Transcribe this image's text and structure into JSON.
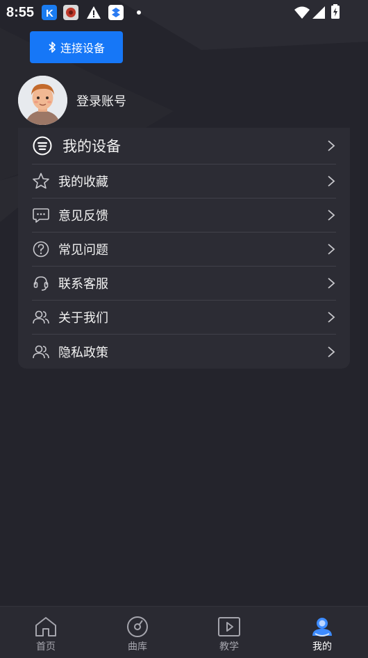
{
  "status_bar": {
    "time": "8:55",
    "icons": [
      "k-app-icon",
      "red-app-icon",
      "warning-icon",
      "layers-app-icon",
      "dot-icon",
      "wifi-icon",
      "signal-icon",
      "battery-charging-icon"
    ]
  },
  "header": {
    "connect_label": "连接设备",
    "connect_icon": "bluetooth-icon"
  },
  "profile": {
    "login_text": "登录账号",
    "avatar_icon": "user-avatar"
  },
  "menu": {
    "items": [
      {
        "label": "我的设备",
        "icon": "device-list-icon"
      },
      {
        "label": "我的收藏",
        "icon": "star-icon"
      },
      {
        "label": "意见反馈",
        "icon": "chat-bubble-icon"
      },
      {
        "label": "常见问题",
        "icon": "question-icon"
      },
      {
        "label": "联系客服",
        "icon": "headset-icon"
      },
      {
        "label": "关于我们",
        "icon": "users-icon"
      },
      {
        "label": "隐私政策",
        "icon": "users-icon"
      }
    ]
  },
  "bottom_nav": {
    "active": "我的",
    "items": [
      {
        "label": "首页",
        "icon": "home-icon"
      },
      {
        "label": "曲库",
        "icon": "disc-icon"
      },
      {
        "label": "教学",
        "icon": "play-video-icon"
      },
      {
        "label": "我的",
        "icon": "profile-icon"
      }
    ]
  },
  "colors": {
    "accent": "#1677f7",
    "background": "#24242c",
    "card": "#2c2c34",
    "nav_active": "#3d8bff"
  }
}
